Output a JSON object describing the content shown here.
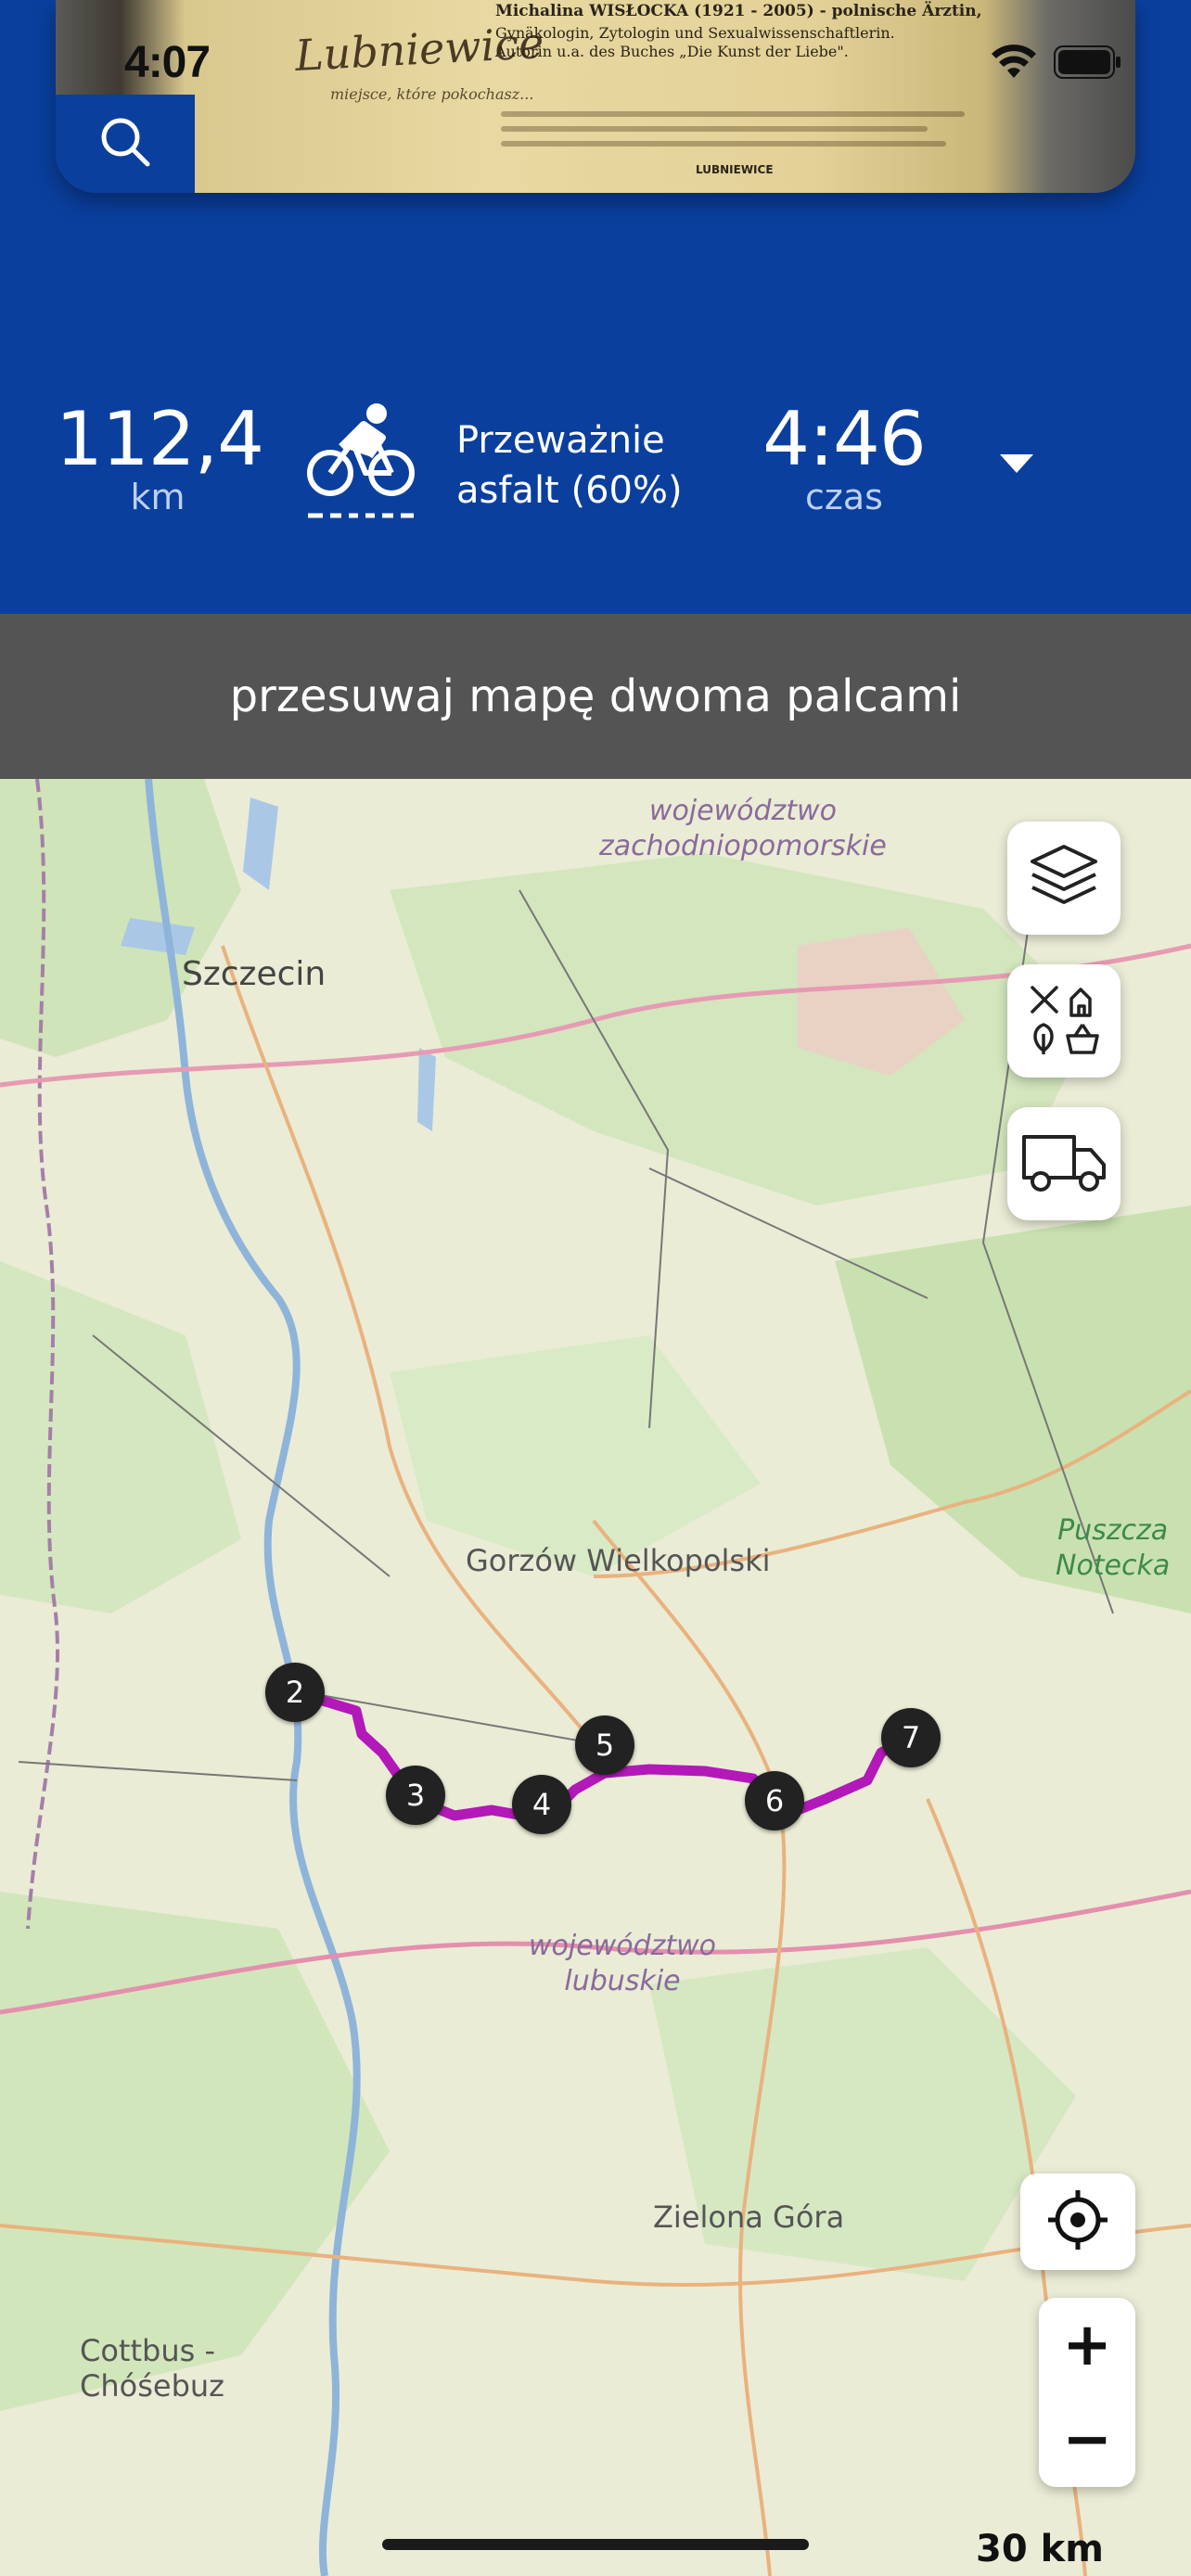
{
  "statusbar": {
    "time": "4:07"
  },
  "header_photo": {
    "logo_text": "Lubniewice",
    "logo_sub": "miejsce, które pokochasz...",
    "headline": "Michalina WISŁOCKA (1921 - 2005) - polnische Ärztin,",
    "subline": "Gynäkologin, Zytologin und Sexualwissenschaftlerin. Autorin u.a. des Buches „Die Kunst der Liebe\".",
    "badge": "LUBNIEWICE"
  },
  "stats": {
    "distance_value": "112,4",
    "distance_unit": "km",
    "surface_line1": "Przeważnie",
    "surface_line2": "asfalt (60%)",
    "time_value": "4:46",
    "time_unit": "czas"
  },
  "hint": {
    "text": "przesuwaj mapę dwoma palcami"
  },
  "map": {
    "labels": {
      "szczecin": "Szczecin",
      "region_zach_1": "województwo",
      "region_zach_2": "zachodniopomorskie",
      "gorzow": "Gorzów Wielkopolski",
      "puszcza_1": "Puszcza",
      "puszcza_2": "Notecka",
      "region_lub_1": "województwo",
      "region_lub_2": "lubuskie",
      "zielona": "Zielona Góra",
      "cottbus_1": "Cottbus -",
      "cottbus_2": "Chóśebuz"
    },
    "waypoints": [
      "2",
      "3",
      "4",
      "5",
      "6",
      "7"
    ],
    "route_color": "#b318b8",
    "scale": "30 km",
    "zoom_in": "+",
    "zoom_out": "−"
  },
  "colors": {
    "primary": "#0a3f9e",
    "hint_bar": "#545454"
  }
}
